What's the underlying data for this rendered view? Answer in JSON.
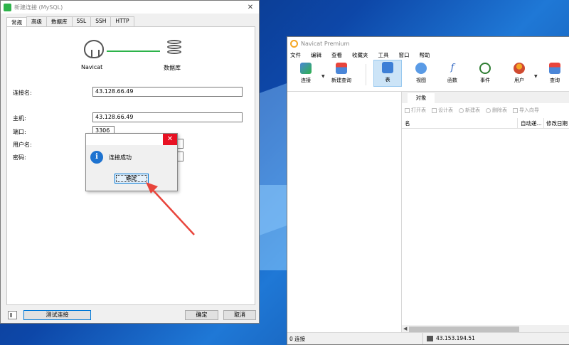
{
  "dialog": {
    "title": "新建连接 (MySQL)",
    "close_glyph": "✕",
    "tabs": [
      "常规",
      "高级",
      "数据库",
      "SSL",
      "SSH",
      "HTTP"
    ],
    "diagram": {
      "left_label": "Navicat",
      "right_label": "数据库"
    },
    "fields": {
      "conn_name_label": "连接名:",
      "conn_name_value": "43.128.66.49",
      "host_label": "主机:",
      "host_value": "43.128.66.49",
      "port_label": "端口:",
      "port_value": "3306",
      "user_label": "用户名:",
      "password_label": "密码:"
    },
    "buttons": {
      "test": "测试连接",
      "ok": "确定",
      "cancel": "取消"
    }
  },
  "message_box": {
    "close_glyph": "✕",
    "icon_glyph": "i",
    "text": "连接成功",
    "ok": "确定"
  },
  "navicat": {
    "title": "Navicat Premium",
    "menu": [
      "文件",
      "编辑",
      "查看",
      "收藏夹",
      "工具",
      "窗口",
      "帮助"
    ],
    "toolbar": [
      "连接",
      "新建查询",
      "表",
      "视图",
      "函数",
      "事件",
      "用户",
      "查询"
    ],
    "active_tool": "表",
    "object_tab": "对象",
    "object_actions": [
      "打开表",
      "设计表",
      "新建表",
      "删除表",
      "导入向导"
    ],
    "columns": [
      "名",
      "自动递...",
      "修改日期"
    ],
    "status": {
      "connections": "0 连接",
      "host": "43.153.194.51"
    }
  },
  "colors": {
    "accent": "#0078d7",
    "close_red": "#e81123",
    "info_blue": "#1e73d0",
    "connect_green": "#2db34a",
    "arrow_red": "#e8453c"
  }
}
